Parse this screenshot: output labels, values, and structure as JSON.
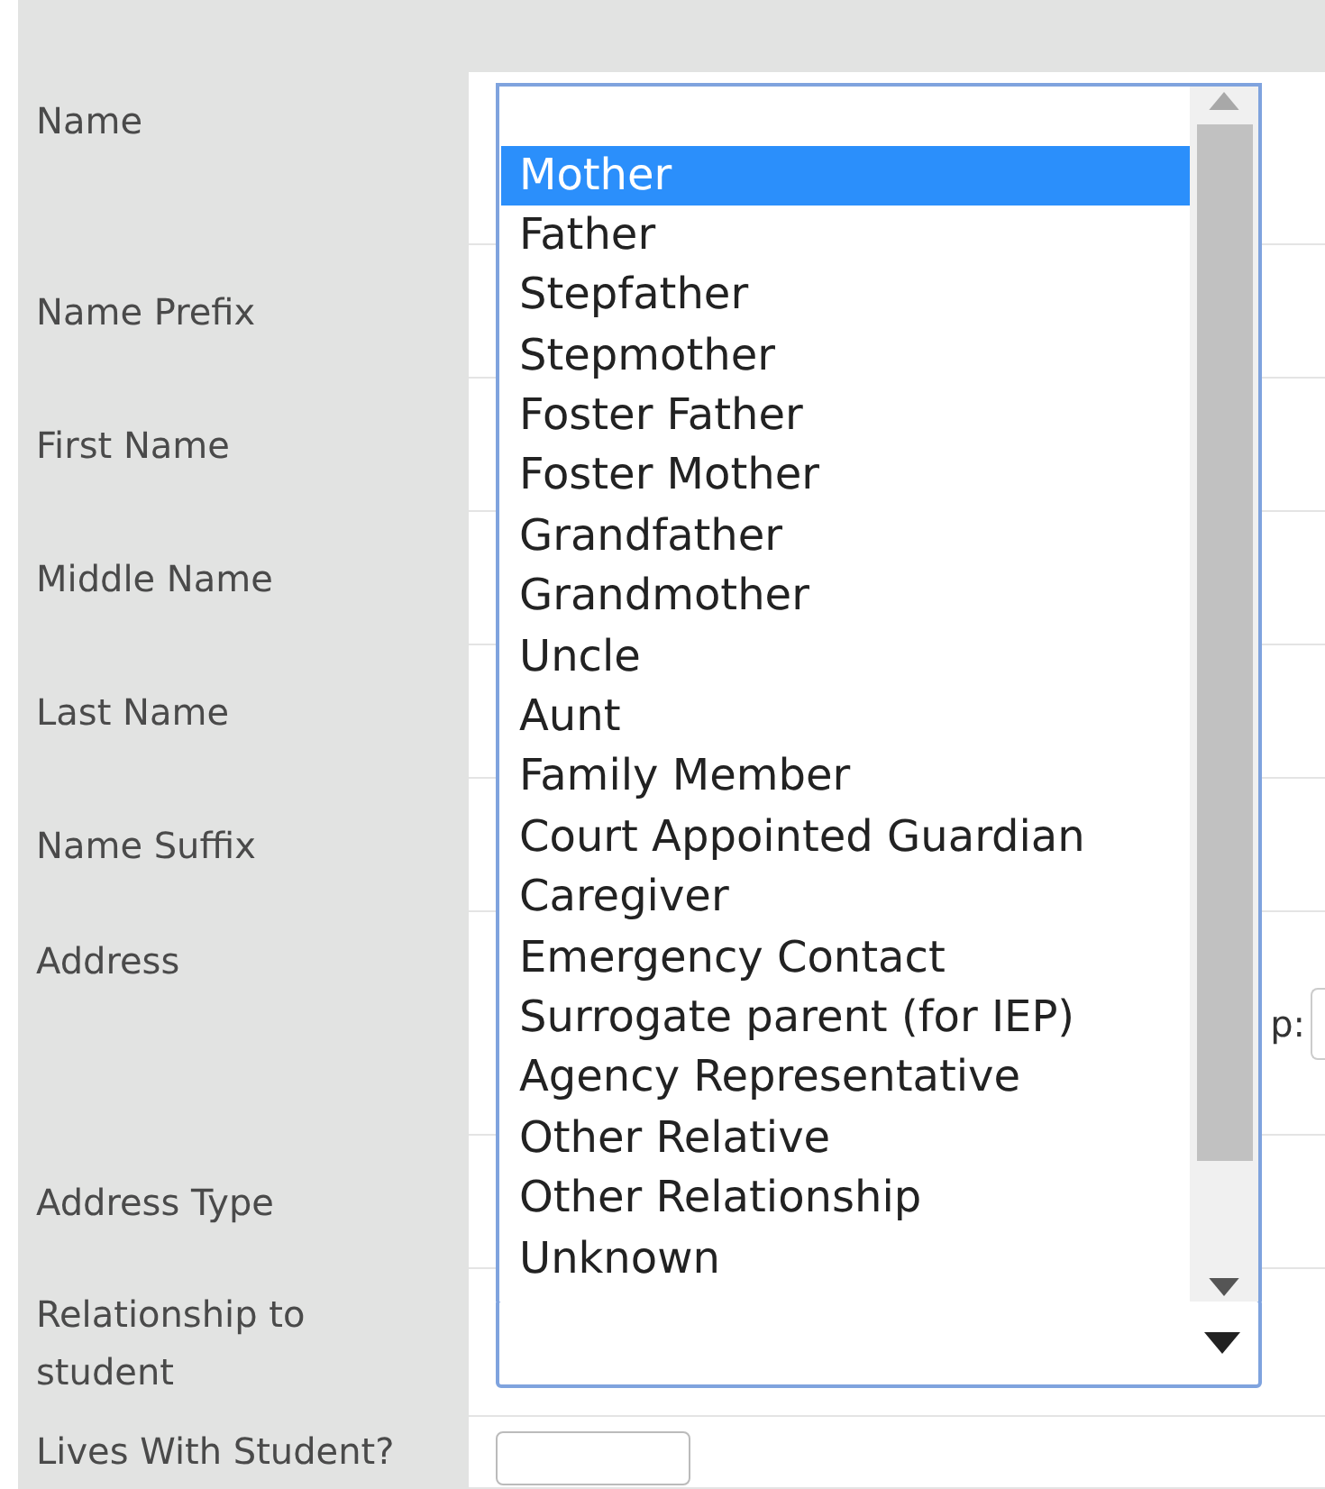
{
  "rows": [
    {
      "kind": "text",
      "label": "Name"
    },
    {
      "kind": "text",
      "label": "Name Prefix"
    },
    {
      "kind": "text",
      "label": "First Name"
    },
    {
      "kind": "text",
      "label": "Middle Name"
    },
    {
      "kind": "text",
      "label": "Last Name"
    },
    {
      "kind": "text",
      "label": "Name Suffix"
    },
    {
      "kind": "address",
      "label": "Address",
      "zip_label": "p:"
    },
    {
      "kind": "text",
      "label": "Address Type"
    },
    {
      "kind": "select",
      "label": "Relationship to student",
      "expanded": true,
      "options": [
        {
          "label": "Mother",
          "selected": true
        },
        {
          "label": "Father",
          "selected": false
        },
        {
          "label": "Stepfather",
          "selected": false
        },
        {
          "label": "Stepmother",
          "selected": false
        },
        {
          "label": "Foster Father",
          "selected": false
        },
        {
          "label": "Foster Mother",
          "selected": false
        },
        {
          "label": "Grandfather",
          "selected": false
        },
        {
          "label": "Grandmother",
          "selected": false
        },
        {
          "label": "Uncle",
          "selected": false
        },
        {
          "label": "Aunt",
          "selected": false
        },
        {
          "label": "Family Member",
          "selected": false
        },
        {
          "label": "Court Appointed Guardian",
          "selected": false
        },
        {
          "label": "Caregiver",
          "selected": false
        },
        {
          "label": "Emergency Contact",
          "selected": false
        },
        {
          "label": "Surrogate parent (for IEP)",
          "selected": false
        },
        {
          "label": "Agency Representative",
          "selected": false
        },
        {
          "label": "Other Relative",
          "selected": false
        },
        {
          "label": "Other Relationship",
          "selected": false
        },
        {
          "label": "Unknown",
          "selected": false
        }
      ]
    },
    {
      "kind": "checkbox",
      "label": "Lives With Student?"
    }
  ]
}
